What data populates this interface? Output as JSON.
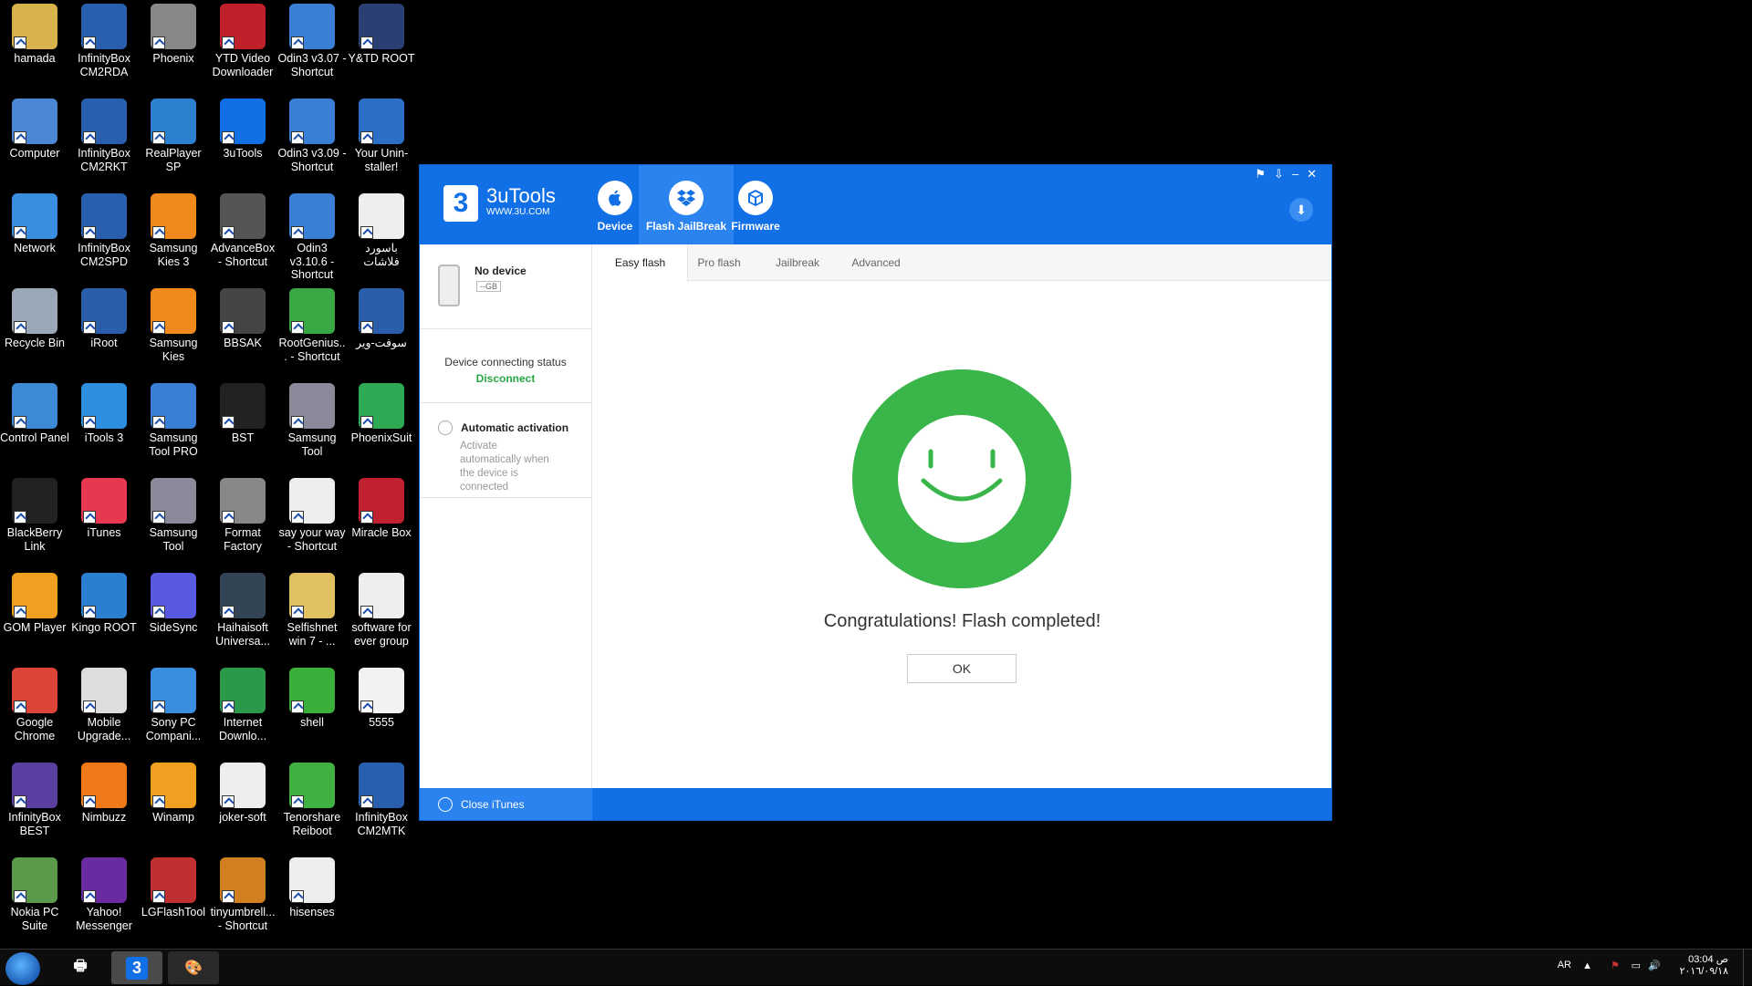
{
  "desktop": {
    "icons": [
      {
        "label": "hamada",
        "icon": "folder-icon",
        "color": "#d8b24a"
      },
      {
        "label": "InfinityBox CM2RDA",
        "icon": "infinitybox-icon",
        "color": "#2a5fb0"
      },
      {
        "label": "Phoenix",
        "icon": "tools-icon",
        "color": "#888888"
      },
      {
        "label": "YTD Video Downloader",
        "icon": "ytd-icon",
        "color": "#c0202a"
      },
      {
        "label": "Odin3 v3.07 - Shortcut",
        "icon": "odin-icon",
        "color": "#3a7fd6"
      },
      {
        "label": "Y&TD ROOT",
        "icon": "android-root-icon",
        "color": "#2a3f73"
      },
      {
        "label": "Computer",
        "icon": "computer-icon",
        "color": "#4a88d6"
      },
      {
        "label": "InfinityBox CM2RKT",
        "icon": "infinitybox-icon",
        "color": "#2a5fb0"
      },
      {
        "label": "RealPlayer SP",
        "icon": "realplayer-icon",
        "color": "#2d7fd0"
      },
      {
        "label": "3uTools",
        "icon": "3utools-icon",
        "color": "#1170e5"
      },
      {
        "label": "Odin3 v3.09 - Shortcut",
        "icon": "odin-icon",
        "color": "#3a7fd6"
      },
      {
        "label": "Your Unin-staller!",
        "icon": "uninstaller-icon",
        "color": "#2b6fc7"
      },
      {
        "label": "Network",
        "icon": "network-icon",
        "color": "#3a8ee0"
      },
      {
        "label": "InfinityBox CM2SPD",
        "icon": "infinitybox-icon",
        "color": "#2a5fb0"
      },
      {
        "label": "Samsung Kies 3",
        "icon": "kies-icon",
        "color": "#f08a1c"
      },
      {
        "label": "AdvanceBox - Shortcut",
        "icon": "advancebox-icon",
        "color": "#555555"
      },
      {
        "label": "Odin3 v3.10.6 - Shortcut",
        "icon": "odin-icon",
        "color": "#3a7fd6"
      },
      {
        "label": "باسورد فلاشات",
        "icon": "document-icon",
        "color": "#eeeeee"
      },
      {
        "label": "Recycle Bin",
        "icon": "recycle-bin-icon",
        "color": "#9aa8b8"
      },
      {
        "label": "iRoot",
        "icon": "iroot-icon",
        "color": "#2b5eaa"
      },
      {
        "label": "Samsung Kies",
        "icon": "kies-icon",
        "color": "#f08a1c"
      },
      {
        "label": "BBSAK",
        "icon": "bbsak-icon",
        "color": "#444444"
      },
      {
        "label": "RootGenius... - Shortcut",
        "icon": "rootgenius-icon",
        "color": "#3aa845"
      },
      {
        "label": "سوفت-وير",
        "icon": "word-doc-icon",
        "color": "#2b5eaa"
      },
      {
        "label": "Control Panel",
        "icon": "control-panel-icon",
        "color": "#3d8ad6"
      },
      {
        "label": "iTools 3",
        "icon": "itools-icon",
        "color": "#2d8fe0"
      },
      {
        "label": "Samsung Tool PRO",
        "icon": "gear-icon",
        "color": "#3a7fd6"
      },
      {
        "label": "BST",
        "icon": "bst-icon",
        "color": "#222222"
      },
      {
        "label": "Samsung Tool",
        "icon": "gear-icon",
        "color": "#8a8a9a"
      },
      {
        "label": "PhoenixSuit",
        "icon": "phoenixsuit-icon",
        "color": "#2eaa55"
      },
      {
        "label": "BlackBerry Link",
        "icon": "blackberry-icon",
        "color": "#222222"
      },
      {
        "label": "iTunes",
        "icon": "itunes-icon",
        "color": "#e8384f"
      },
      {
        "label": "Samsung Tool",
        "icon": "gear-icon",
        "color": "#8a8a9a"
      },
      {
        "label": "Format Factory",
        "icon": "format-factory-icon",
        "color": "#888888"
      },
      {
        "label": "say your way - Shortcut",
        "icon": "document-icon",
        "color": "#eeeeee"
      },
      {
        "label": "Miracle Box",
        "icon": "miracle-box-icon",
        "color": "#c02030"
      },
      {
        "label": "GOM Player",
        "icon": "gom-player-icon",
        "color": "#f0a020"
      },
      {
        "label": "Kingo ROOT",
        "icon": "kingo-root-icon",
        "color": "#2b7fd0"
      },
      {
        "label": "SideSync",
        "icon": "sidesync-icon",
        "color": "#5a5ae0"
      },
      {
        "label": "Haihaisoft Universa...",
        "icon": "film-icon",
        "color": "#334455"
      },
      {
        "label": "Selfishnet win 7 - ...",
        "icon": "folder-icon",
        "color": "#e0c060"
      },
      {
        "label": "software for ever group",
        "icon": "document-icon",
        "color": "#eeeeee"
      },
      {
        "label": "Google Chrome",
        "icon": "chrome-icon",
        "color": "#db4437"
      },
      {
        "label": "Mobile Upgrade...",
        "icon": "gear-icon",
        "color": "#dddddd"
      },
      {
        "label": "Sony PC Compani...",
        "icon": "sony-icon",
        "color": "#3a8ee0"
      },
      {
        "label": "Internet Downlo...",
        "icon": "idm-icon",
        "color": "#2a9a4a"
      },
      {
        "label": "shell",
        "icon": "play-icon",
        "color": "#3ab03a"
      },
      {
        "label": "5555",
        "icon": "image-file-icon",
        "color": "#f2f2f2"
      },
      {
        "label": "InfinityBox BEST",
        "icon": "infinitybox-icon",
        "color": "#5a3fa0"
      },
      {
        "label": "Nimbuzz",
        "icon": "nimbuzz-icon",
        "color": "#f07a1a"
      },
      {
        "label": "Winamp",
        "icon": "winamp-icon",
        "color": "#f0a020"
      },
      {
        "label": "joker-soft",
        "icon": "document-icon",
        "color": "#eeeeee"
      },
      {
        "label": "Tenorshare Reiboot",
        "icon": "reiboot-icon",
        "color": "#40b040"
      },
      {
        "label": "InfinityBox CM2MTK",
        "icon": "infinitybox-icon",
        "color": "#2a5fb0"
      },
      {
        "label": "Nokia PC Suite",
        "icon": "nokia-icon",
        "color": "#5a9a4a"
      },
      {
        "label": "Yahoo! Messenger",
        "icon": "yahoo-icon",
        "color": "#6a2aa0"
      },
      {
        "label": "LGFlashTool",
        "icon": "lgflashtool-icon",
        "color": "#c03030"
      },
      {
        "label": "tinyumbrell... - Shortcut",
        "icon": "umbrella-icon",
        "color": "#d08020"
      },
      {
        "label": "hisenses",
        "icon": "document-icon",
        "color": "#eeeeee"
      }
    ]
  },
  "window": {
    "brand_name": "3uTools",
    "brand_url": "WWW.3U.COM",
    "logo_glyph": "3",
    "controls": [
      "⚑",
      "⇩",
      "–",
      "✕"
    ],
    "nav": [
      {
        "label": "Device",
        "icon": "apple-icon",
        "glyph": ""
      },
      {
        "label": "Flash JailBreak",
        "icon": "dropbox-icon",
        "glyph": "❖"
      },
      {
        "label": "Firmware",
        "icon": "box-icon",
        "glyph": "⬢"
      }
    ],
    "download_glyph": "⬇",
    "device_name": "No device",
    "device_storage": "--GB",
    "connect_label": "Device connecting status",
    "connect_status": "Disconnect",
    "auto_title": "Automatic activation",
    "auto_desc": "Activate automatically when the device is connected",
    "subtabs": [
      "Easy flash",
      "Pro flash",
      "Jailbreak",
      "Advanced"
    ],
    "message": "Congratulations! Flash completed!",
    "ok_label": "OK",
    "close_itunes": "Close iTunes",
    "accent": "#1170e5",
    "success_color": "#39b54a"
  },
  "taskbar": {
    "apps": [
      {
        "icon": "printer-icon",
        "glyph": "🖶"
      },
      {
        "icon": "3utools-icon",
        "glyph": "3"
      },
      {
        "icon": "paint-icon",
        "glyph": "🎨"
      }
    ],
    "lang": "AR",
    "time": "03:04 ص",
    "date": "٢٠١٦/٠٩/١٨"
  }
}
